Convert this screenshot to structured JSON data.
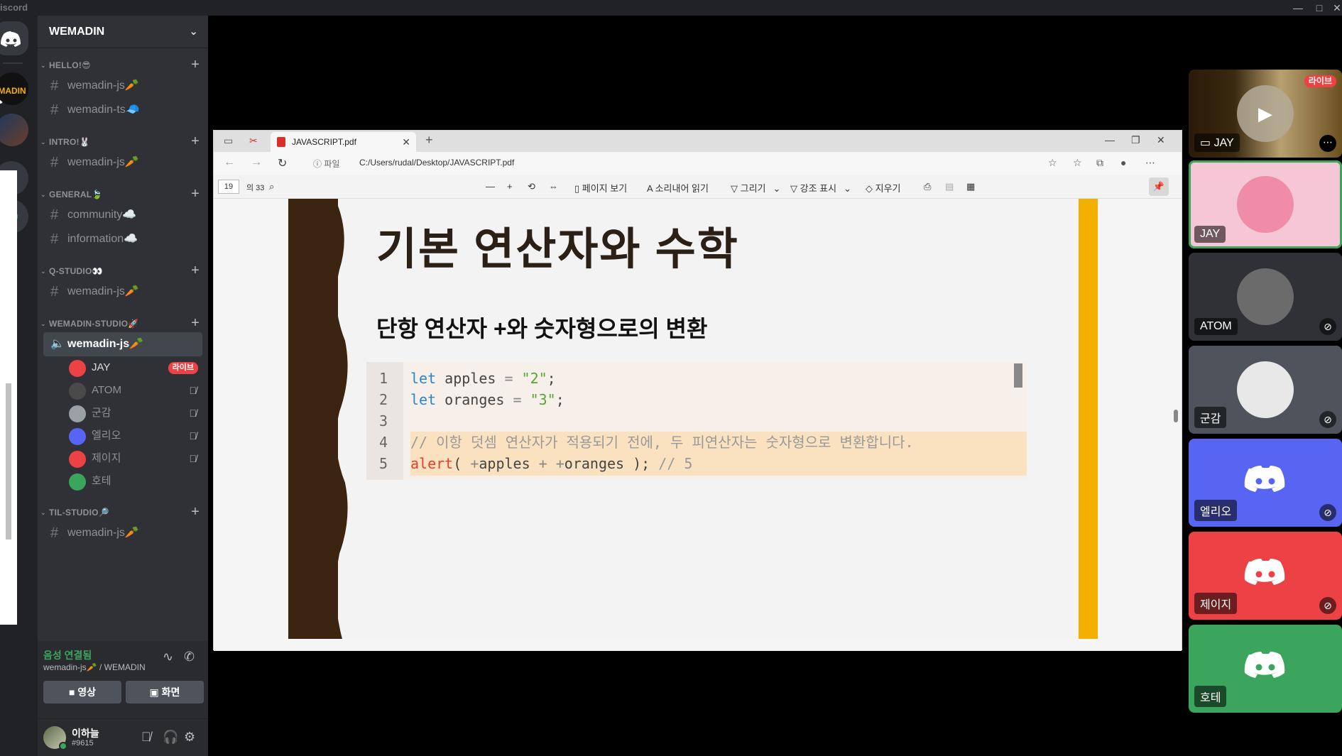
{
  "app": {
    "title": "iscord",
    "window_controls": [
      "—",
      "□",
      "✕"
    ]
  },
  "rail": {
    "servers": [
      "home",
      "wemadin",
      "code-server"
    ],
    "add_label": "+"
  },
  "sidebar": {
    "server_name": "WEMADIN",
    "categories": [
      {
        "name": "HELLO!😎",
        "channels": [
          "wemadin-js🥕",
          "wemadin-ts🧢"
        ]
      },
      {
        "name": "INTRO!🐰",
        "channels": [
          "wemadin-js🥕"
        ]
      },
      {
        "name": "GENERAL🍃",
        "channels": [
          "community☁️",
          "information☁️"
        ]
      },
      {
        "name": "Q-STUDIO👀",
        "channels": [
          "wemadin-js🥕"
        ]
      },
      {
        "name": "WEMADIN-STUDIO🚀",
        "channels": []
      },
      {
        "name": "TIL-STUDIO🔎",
        "channels": [
          "wemadin-js🥕"
        ]
      }
    ],
    "voice_channel": "wemadin-js🥕",
    "voice_users": [
      {
        "name": "JAY",
        "live": "라이브",
        "color": "#ed4245"
      },
      {
        "name": "ATOM",
        "color": "#4a4a4a"
      },
      {
        "name": "군감",
        "color": "#9aa0a6"
      },
      {
        "name": "엘리오",
        "color": "#5865f2"
      },
      {
        "name": "제이지",
        "color": "#ed4245"
      },
      {
        "name": "호테",
        "color": "#3ba55d"
      }
    ],
    "voice_panel": {
      "status": "음성 연결됨",
      "sub": "wemadin-js🥕 / WEMADIN",
      "video_label": "영상",
      "screen_label": "화면"
    },
    "user": {
      "name": "이하늘",
      "tag": "#9615"
    }
  },
  "browser": {
    "tab_title": "JAVASCRIPT.pdf",
    "file_label": "파일",
    "url": "C:/Users/rudal/Desktop/JAVASCRIPT.pdf",
    "page_current": "19",
    "page_total": "의 33",
    "toolbar": {
      "page_view": "페이지 보기",
      "read_aloud": "소리내어 읽기",
      "draw": "그리기",
      "highlight": "강조 표시",
      "erase": "지우기"
    }
  },
  "slide": {
    "title": "기본 연산자와 수학",
    "subtitle": "단항 연산자 +와 숫자형으로의 변환",
    "code_lines": [
      {
        "n": "1",
        "parts": [
          [
            "kw",
            "let"
          ],
          [
            "",
            " apples "
          ],
          [
            "op",
            "="
          ],
          [
            "",
            " "
          ],
          [
            "str",
            "\"2\""
          ],
          [
            "",
            ";"
          ]
        ]
      },
      {
        "n": "2",
        "parts": [
          [
            "kw",
            "let"
          ],
          [
            "",
            " oranges "
          ],
          [
            "op",
            "="
          ],
          [
            "",
            " "
          ],
          [
            "str",
            "\"3\""
          ],
          [
            "",
            ";"
          ]
        ]
      },
      {
        "n": "3",
        "parts": []
      },
      {
        "n": "4",
        "parts": [
          [
            "cm",
            "// 이항 덧셈 연산자가 적용되기 전에, 두 피연산자는 숫자형으로 변환합니다."
          ]
        ]
      },
      {
        "n": "5",
        "parts": [
          [
            "fn",
            "alert"
          ],
          [
            "",
            "( "
          ],
          [
            "op",
            "+"
          ],
          [
            "",
            "apples "
          ],
          [
            "op",
            "+"
          ],
          [
            "",
            " "
          ],
          [
            "op",
            "+"
          ],
          [
            "",
            "oranges ); "
          ],
          [
            "cm",
            "// 5"
          ]
        ]
      }
    ]
  },
  "tiles": [
    {
      "name": "JAY",
      "kind": "stream",
      "live": "라이브"
    },
    {
      "name": "JAY",
      "kind": "avatar",
      "bg": "#f5c6d6",
      "avatar_color": "#f08ca8"
    },
    {
      "name": "ATOM",
      "kind": "avatar",
      "bg": "#2f3136",
      "avatar_color": "#6b6b6b"
    },
    {
      "name": "군감",
      "kind": "avatar",
      "bg": "#4f545c",
      "avatar_color": "#e8e8e8"
    },
    {
      "name": "엘리오",
      "kind": "logo",
      "bg": "#5865f2"
    },
    {
      "name": "제이지",
      "kind": "logo",
      "bg": "#ed4245"
    },
    {
      "name": "호테",
      "kind": "logo",
      "bg": "#3ba55d"
    }
  ],
  "colors": {
    "live": "#ed4245",
    "voice_connected": "#3ba55d",
    "blurple": "#5865f2"
  }
}
